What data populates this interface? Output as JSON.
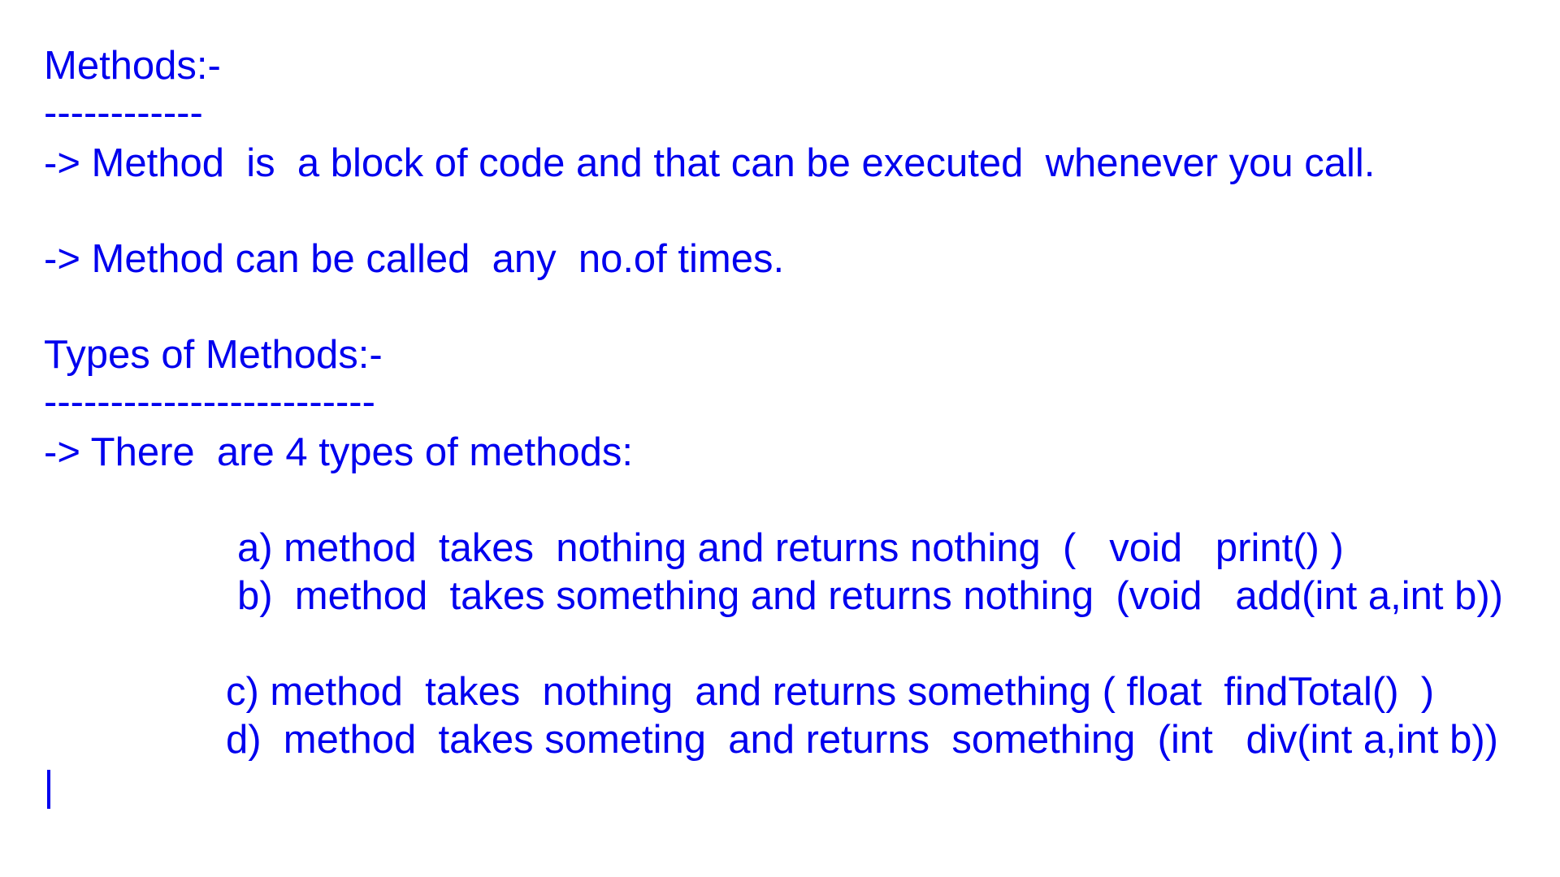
{
  "document": {
    "lines": {
      "heading_methods": "Methods:-",
      "underline_methods": "------------",
      "method_def": "-> Method  is  a block of code and that can be executed  whenever you call.",
      "method_calls": "-> Method can be called  any  no.of times.",
      "heading_types": "Types of Methods:-",
      "underline_types": "-------------------------",
      "types_intro": "-> There  are 4 types of methods:",
      "type_a": "a) method  takes  nothing and returns nothing  (   void   print() )",
      "type_b": "b)  method  takes something and returns nothing  (void   add(int a,int b))",
      "type_c": "c) method  takes  nothing  and returns something ( float  findTotal()  )",
      "type_d": "d)  method  takes someting  and returns  something  (int   div(int a,int b))"
    },
    "text_color": "#0000ee"
  }
}
